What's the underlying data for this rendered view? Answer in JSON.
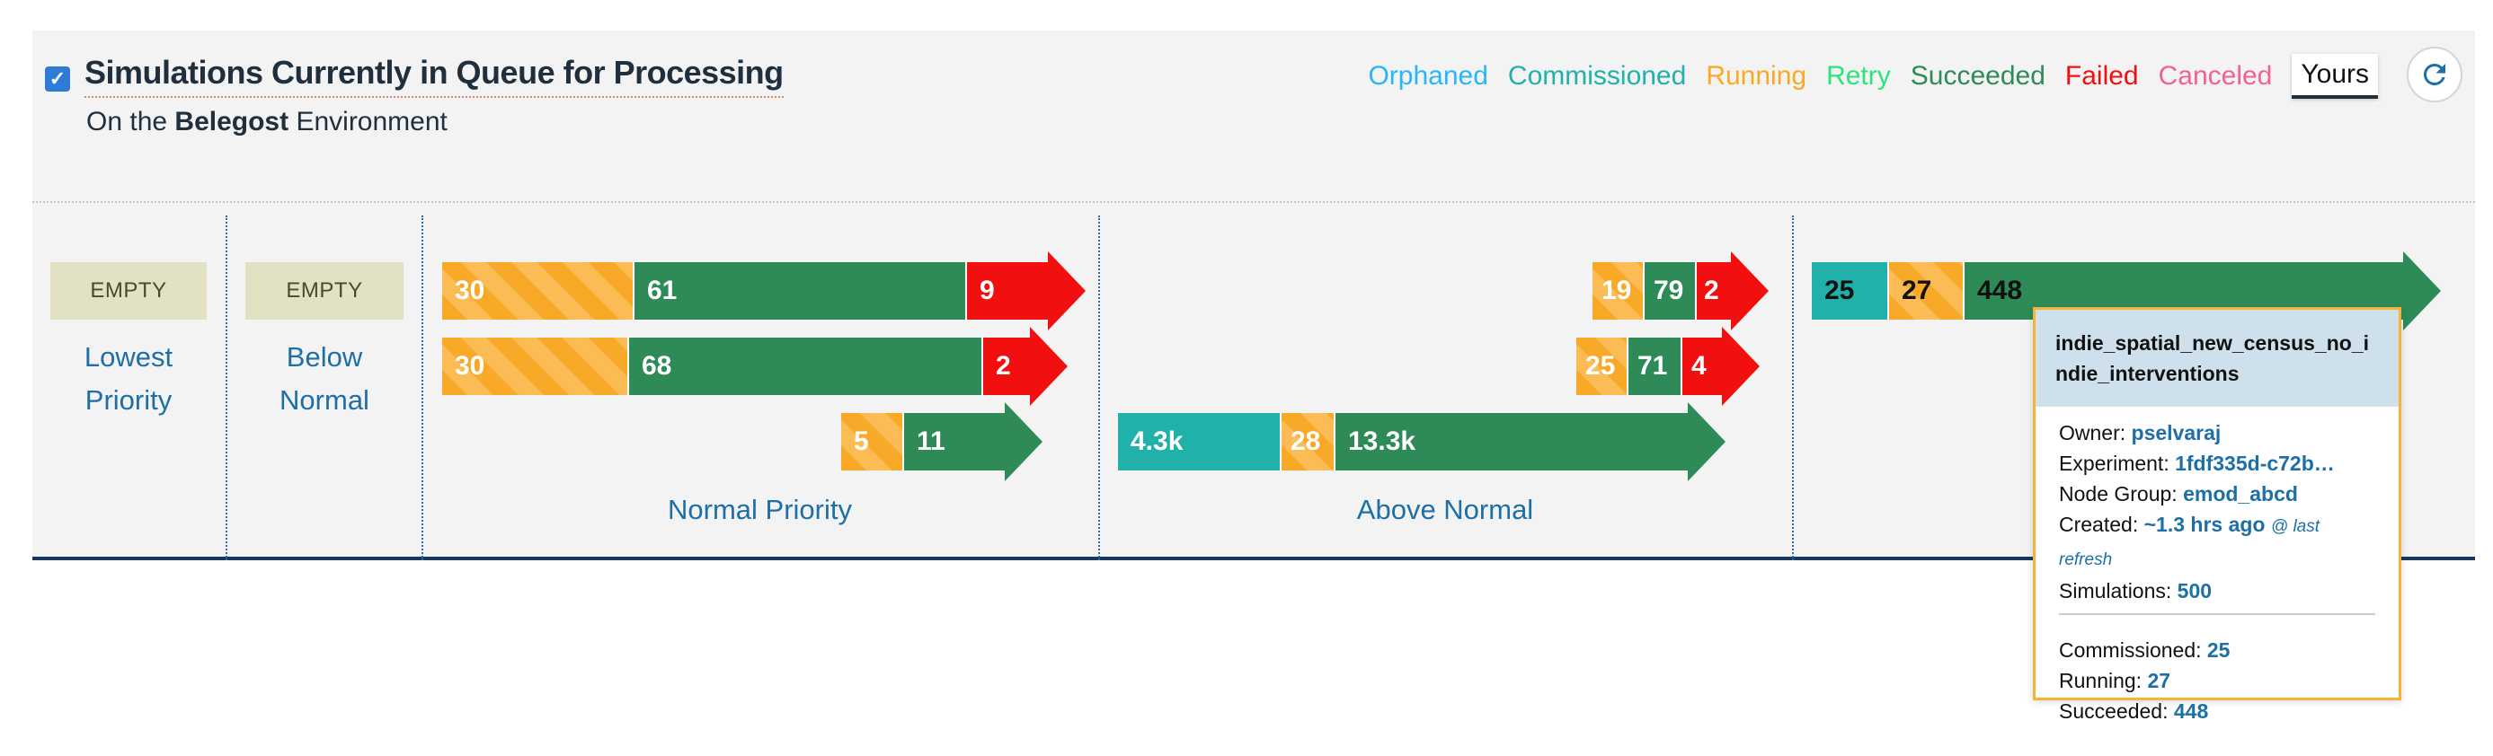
{
  "header": {
    "title": "Simulations Currently in Queue for Processing",
    "subtitle_prefix": "On the",
    "environment": "Belegost",
    "subtitle_suffix": "Environment",
    "checkbox_checked": true
  },
  "legend": {
    "orphaned": "Orphaned",
    "commissioned": "Commissioned",
    "running": "Running",
    "retry": "Retry",
    "succeeded": "Succeeded",
    "failed": "Failed",
    "canceled": "Canceled",
    "yours": "Yours"
  },
  "colors": {
    "orphaned": "#29b6f6",
    "commissioned": "#20b2aa",
    "running": "#f8a928",
    "retry": "#2ee37f",
    "succeeded": "#2e8b57",
    "failed": "#f20f0f",
    "canceled": "#f06292",
    "yours": "#111111"
  },
  "refresh_icon": "refresh-icon",
  "lanes": {
    "lowest": {
      "empty": "EMPTY",
      "label_line1": "Lowest",
      "label_line2": "Priority"
    },
    "below_normal": {
      "empty": "EMPTY",
      "label_line1": "Below",
      "label_line2": "Normal"
    },
    "normal": {
      "label": "Normal Priority",
      "bars": [
        {
          "running": "30",
          "succeeded": "61",
          "failed": "9"
        },
        {
          "running": "30",
          "succeeded": "68",
          "failed": "2"
        },
        {
          "running": "5",
          "succeeded": "11"
        }
      ]
    },
    "above_normal": {
      "label": "Above Normal",
      "bars": [
        {
          "running": "19",
          "succeeded": "79",
          "failed": "2"
        },
        {
          "running": "25",
          "succeeded": "71",
          "failed": "4"
        },
        {
          "commissioned": "4.3k",
          "running": "28",
          "succeeded": "13.3k"
        }
      ]
    },
    "high": {
      "bars": [
        {
          "commissioned": "25",
          "running": "27",
          "succeeded": "448"
        }
      ]
    }
  },
  "tooltip": {
    "name": "indie_spatial_new_census_no_indie_interventions",
    "owner_label": "Owner:",
    "owner": "pselvaraj",
    "experiment_label": "Experiment:",
    "experiment": "1fdf335d-c72b…",
    "node_group_label": "Node Group:",
    "node_group": "emod_abcd",
    "created_label": "Created:",
    "created": "~1.3 hrs ago",
    "created_note": "@ last refresh",
    "simulations_label": "Simulations:",
    "simulations": "500",
    "commissioned_label": "Commissioned:",
    "commissioned": "25",
    "running_label": "Running:",
    "running": "27",
    "succeeded_label": "Succeeded:",
    "succeeded": "448"
  }
}
